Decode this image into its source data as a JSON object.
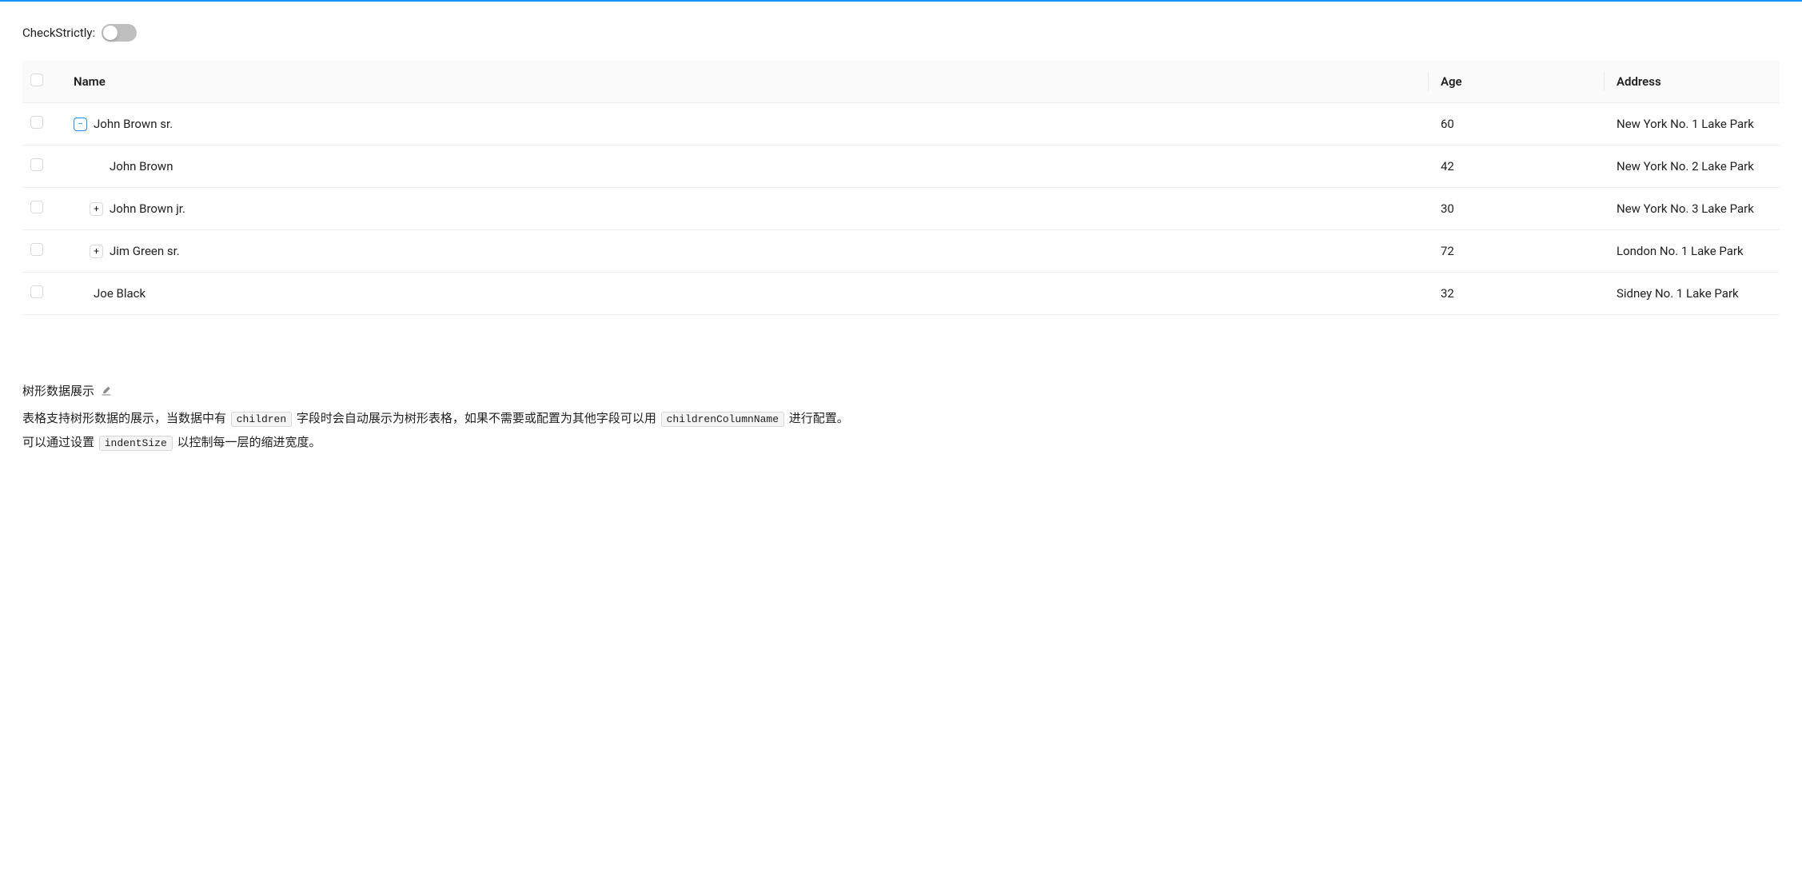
{
  "header": {
    "toggle_label": "CheckStrictly:",
    "toggle_on": false
  },
  "table": {
    "columns": [
      "Name",
      "Age",
      "Address"
    ],
    "rows": [
      {
        "indent": 0,
        "expand": "expanded",
        "name": "John Brown sr.",
        "age": "60",
        "address": "New York No. 1 Lake Park"
      },
      {
        "indent": 1,
        "expand": "none",
        "name": "John Brown",
        "age": "42",
        "address": "New York No. 2 Lake Park"
      },
      {
        "indent": 1,
        "expand": "collapsed",
        "name": "John Brown jr.",
        "age": "30",
        "address": "New York No. 3 Lake Park"
      },
      {
        "indent": 1,
        "expand": "collapsed",
        "name": "Jim Green sr.",
        "age": "72",
        "address": "London No. 1 Lake Park"
      },
      {
        "indent": 0,
        "expand": "none",
        "name": "Joe Black",
        "age": "32",
        "address": "Sidney No. 1 Lake Park"
      }
    ]
  },
  "doc": {
    "title": "树形数据展示",
    "p1_a": "表格支持树形数据的展示，当数据中有 ",
    "p1_code1": "children",
    "p1_b": " 字段时会自动展示为树形表格，如果不需要或配置为其他字段可以用 ",
    "p1_code2": "childrenColumnName",
    "p1_c": " 进行配置。",
    "p2_a": "可以通过设置 ",
    "p2_code1": "indentSize",
    "p2_b": " 以控制每一层的缩进宽度。"
  }
}
